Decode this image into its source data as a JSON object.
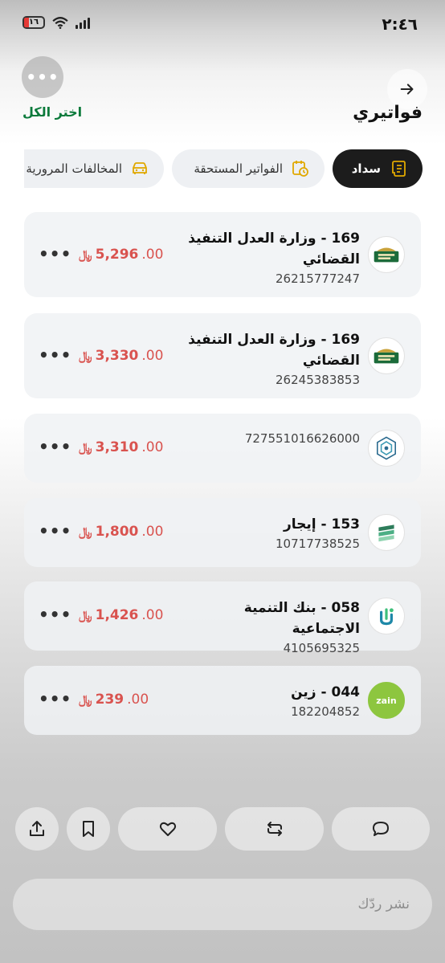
{
  "status_bar": {
    "time": "٢:٤٦",
    "battery_level": "١٦",
    "wifi_icon": "wifi-icon",
    "signal_icon": "signal-icon"
  },
  "header": {
    "title": "فواتيري",
    "select_all": "اختر الكل",
    "back_icon": "arrow-right-icon",
    "more_icon": "more-horizontal-icon",
    "more_label": "•••"
  },
  "tabs": [
    {
      "label": "سداد",
      "icon": "receipt-icon",
      "active": true
    },
    {
      "label": "الفواتير المستحقة",
      "icon": "clock-calendar-icon",
      "active": false
    },
    {
      "label": "المخالفات المرورية",
      "icon": "car-icon",
      "active": false
    }
  ],
  "bills": [
    {
      "name": "169 - وزارة العدل التنفيذ القضائي",
      "account": "26215777247",
      "amount_int": "5,296",
      "amount_dec": ".00",
      "currency": "﷼",
      "logo": "moj-logo"
    },
    {
      "name": "169 - وزارة العدل التنفيذ القضائي",
      "account": "26245383853",
      "amount_int": "3,330",
      "amount_dec": ".00",
      "currency": "﷼",
      "logo": "moj-logo"
    },
    {
      "name": "",
      "account": "727551016626000",
      "amount_int": "3,310",
      "amount_dec": ".00",
      "currency": "﷼",
      "logo": "zatca-logo"
    },
    {
      "name": "153 - إيجار",
      "account": "10717738525",
      "amount_int": "1,800",
      "amount_dec": ".00",
      "currency": "﷼",
      "logo": "ejar-logo"
    },
    {
      "name": "058 - بنك التنمية الاجتماعية",
      "account": "4105695325",
      "amount_int": "1,426",
      "amount_dec": ".00",
      "currency": "﷼",
      "logo": "sdb-logo"
    },
    {
      "name": "044 - زين",
      "account": "182204852",
      "amount_int": "239",
      "amount_dec": ".00",
      "currency": "﷼",
      "logo": "zain-logo",
      "logo_text": "zain"
    }
  ],
  "bill_more_label": "•••",
  "action_bar": {
    "share_icon": "share-icon",
    "bookmark_icon": "bookmark-icon",
    "like_icon": "heart-icon",
    "repost_icon": "repost-icon",
    "reply_icon": "comment-icon"
  },
  "reply": {
    "placeholder": "نشر ردّك"
  },
  "colors": {
    "amount": "#d9534f",
    "select_all": "#0b7a3b",
    "active_tab": "#1c1c1c",
    "tab_icon_gold": "#e0a800",
    "zain_green": "#8dc63f"
  }
}
